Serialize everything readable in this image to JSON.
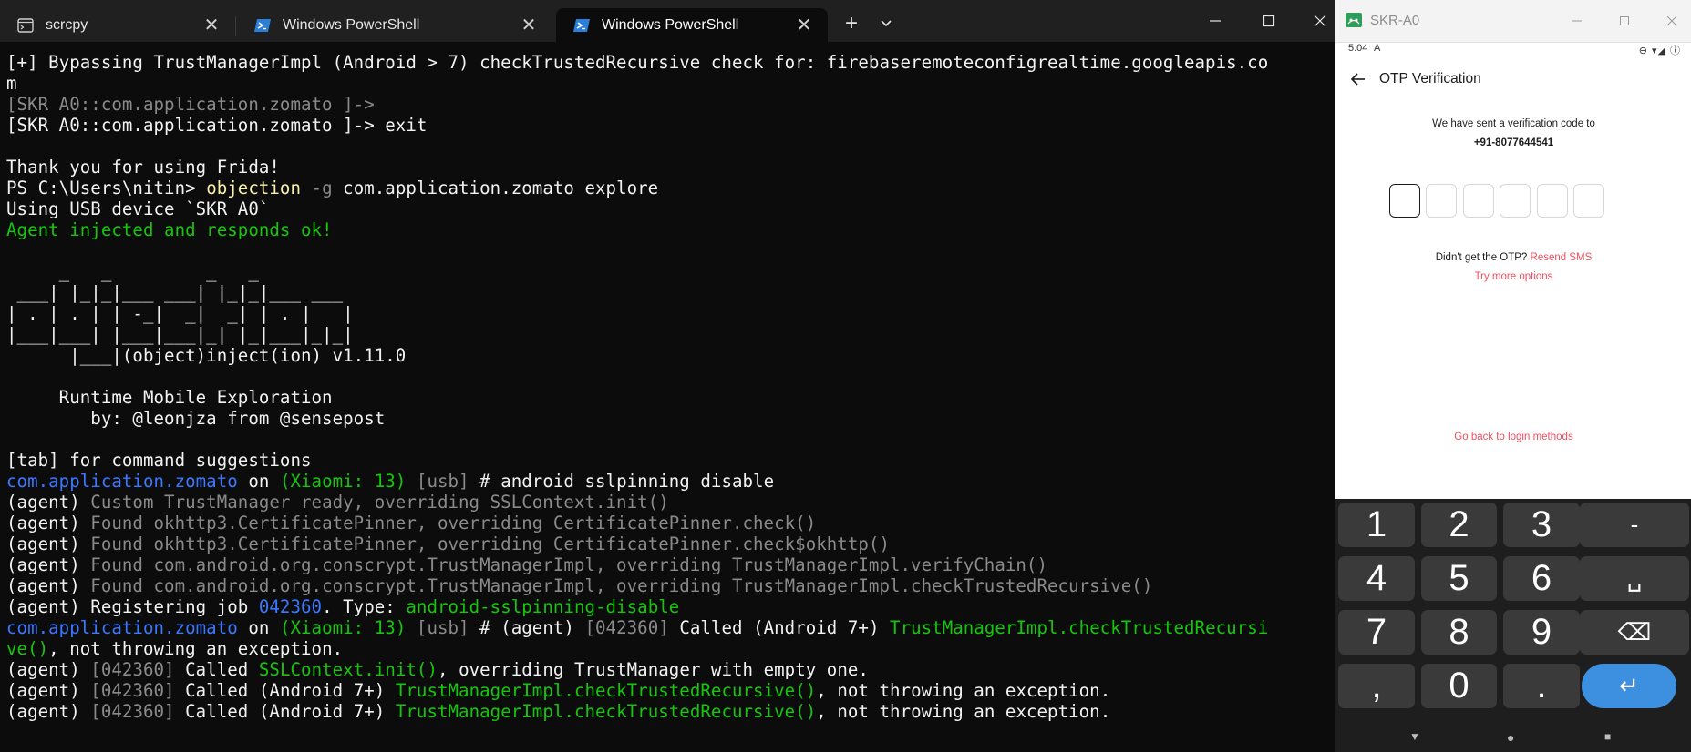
{
  "terminal": {
    "tabs": [
      {
        "title": "scrcpy",
        "icon": "terminal-app-icon",
        "active": false
      },
      {
        "title": "Windows PowerShell",
        "icon": "powershell-icon",
        "active": false
      },
      {
        "title": "Windows PowerShell",
        "icon": "powershell-icon",
        "active": true
      }
    ],
    "new_tab_label": "+",
    "dropdown_label": "⌄",
    "window_controls": {
      "minimize": "—",
      "maximize": "☐",
      "close": "✕"
    },
    "lines": [
      [
        {
          "t": "[+] Bypassing TrustManagerImpl (Android > 7) checkTrustedRecursive check for: firebaseremoteconfigrealtime.googleapis.co",
          "c": "c-white"
        }
      ],
      [
        {
          "t": "m",
          "c": "c-white"
        }
      ],
      [
        {
          "t": "[SKR A0::com.application.zomato ]->",
          "c": "c-grey"
        }
      ],
      [
        {
          "t": "[SKR A0::com.application.zomato ]-> exit",
          "c": "c-white"
        }
      ],
      [
        {
          "t": "",
          "c": ""
        }
      ],
      [
        {
          "t": "Thank you for using Frida!",
          "c": "c-white"
        }
      ],
      [
        {
          "t": "PS C:\\Users\\nitin> ",
          "c": "c-white"
        },
        {
          "t": "objection",
          "c": "c-yellow"
        },
        {
          "t": " -g",
          "c": "c-grey"
        },
        {
          "t": " com.application.zomato explore",
          "c": "c-white"
        }
      ],
      [
        {
          "t": "Using USB device `SKR A0`",
          "c": "c-white"
        }
      ],
      [
        {
          "t": "Agent injected and responds ok!",
          "c": "c-green"
        }
      ],
      [
        {
          "t": "",
          "c": ""
        }
      ],
      [
        {
          "t": "     _   _         _   _",
          "c": "c-white"
        }
      ],
      [
        {
          "t": " ___| |_|_|___ ___| |_|_|___ ___",
          "c": "c-white"
        }
      ],
      [
        {
          "t": "| . | . | | -_|  _|  _| | . |   |",
          "c": "c-white"
        }
      ],
      [
        {
          "t": "|___|___| |___|___|_| |_|___|_|_|",
          "c": "c-white"
        }
      ],
      [
        {
          "t": "      |___|(object)inject(ion) v1.11.0",
          "c": "c-white"
        }
      ],
      [
        {
          "t": "",
          "c": ""
        }
      ],
      [
        {
          "t": "     Runtime Mobile Exploration",
          "c": "c-white"
        }
      ],
      [
        {
          "t": "        by: @leonjza from @sensepost",
          "c": "c-white"
        }
      ],
      [
        {
          "t": "",
          "c": ""
        }
      ],
      [
        {
          "t": "[tab] for command suggestions",
          "c": "c-white"
        }
      ],
      [
        {
          "t": "com.application.zomato",
          "c": "c-blue"
        },
        {
          "t": " on ",
          "c": "c-white"
        },
        {
          "t": "(Xiaomi: 13)",
          "c": "c-green"
        },
        {
          "t": " [usb]",
          "c": "c-grey"
        },
        {
          "t": " # android sslpinning disable",
          "c": "c-white"
        }
      ],
      [
        {
          "t": "(agent)",
          "c": "c-white"
        },
        {
          "t": " Custom TrustManager ready, overriding SSLContext.init()",
          "c": "c-grey"
        }
      ],
      [
        {
          "t": "(agent)",
          "c": "c-white"
        },
        {
          "t": " Found okhttp3.CertificatePinner, overriding CertificatePinner.check()",
          "c": "c-grey"
        }
      ],
      [
        {
          "t": "(agent)",
          "c": "c-white"
        },
        {
          "t": " Found okhttp3.CertificatePinner, overriding CertificatePinner.check$okhttp()",
          "c": "c-grey"
        }
      ],
      [
        {
          "t": "(agent)",
          "c": "c-white"
        },
        {
          "t": " Found com.android.org.conscrypt.TrustManagerImpl, overriding TrustManagerImpl.verifyChain()",
          "c": "c-grey"
        }
      ],
      [
        {
          "t": "(agent)",
          "c": "c-white"
        },
        {
          "t": " Found com.android.org.conscrypt.TrustManagerImpl, overriding TrustManagerImpl.checkTrustedRecursive()",
          "c": "c-grey"
        }
      ],
      [
        {
          "t": "(agent) Registering job ",
          "c": "c-white"
        },
        {
          "t": "042360",
          "c": "c-blue"
        },
        {
          "t": ". Type: ",
          "c": "c-white"
        },
        {
          "t": "android-sslpinning-disable",
          "c": "c-green"
        }
      ],
      [
        {
          "t": "com.application.zomato",
          "c": "c-blue"
        },
        {
          "t": " on ",
          "c": "c-white"
        },
        {
          "t": "(Xiaomi: 13)",
          "c": "c-green"
        },
        {
          "t": " [usb]",
          "c": "c-grey"
        },
        {
          "t": " # (agent) ",
          "c": "c-white"
        },
        {
          "t": "[042360]",
          "c": "c-grey"
        },
        {
          "t": " Called (Android 7+) ",
          "c": "c-white"
        },
        {
          "t": "TrustManagerImpl.checkTrustedRecursi",
          "c": "c-green"
        }
      ],
      [
        {
          "t": "ve()",
          "c": "c-green"
        },
        {
          "t": ", not throwing an exception.",
          "c": "c-white"
        }
      ],
      [
        {
          "t": "(agent) ",
          "c": "c-white"
        },
        {
          "t": "[042360]",
          "c": "c-grey"
        },
        {
          "t": " Called ",
          "c": "c-white"
        },
        {
          "t": "SSLContext.init()",
          "c": "c-green"
        },
        {
          "t": ", overriding TrustManager with empty one.",
          "c": "c-white"
        }
      ],
      [
        {
          "t": "(agent) ",
          "c": "c-white"
        },
        {
          "t": "[042360]",
          "c": "c-grey"
        },
        {
          "t": " Called (Android 7+) ",
          "c": "c-white"
        },
        {
          "t": "TrustManagerImpl.checkTrustedRecursive()",
          "c": "c-green"
        },
        {
          "t": ", not throwing an exception.",
          "c": "c-white"
        }
      ],
      [
        {
          "t": "(agent) ",
          "c": "c-white"
        },
        {
          "t": "[042360]",
          "c": "c-grey"
        },
        {
          "t": " Called (Android 7+) ",
          "c": "c-white"
        },
        {
          "t": "TrustManagerImpl.checkTrustedRecursive()",
          "c": "c-green"
        },
        {
          "t": ", not throwing an exception.",
          "c": "c-white"
        }
      ]
    ]
  },
  "phone": {
    "window_title": "SKR-A0",
    "window_controls": {
      "minimize": "—",
      "maximize": "☐",
      "close": "✕"
    },
    "status": {
      "time": "5:04",
      "left_icon": "A",
      "right_icons": "⊖ ▾◢ ⓘ"
    },
    "appbar": {
      "title": "OTP Verification"
    },
    "sent_text": "We have sent a verification code to",
    "phone_number": "+91-8077644541",
    "otp_box_count": 6,
    "didnt_get": "Didn't get the OTP?",
    "resend": "Resend SMS",
    "more_options": "Try more options",
    "go_back": "Go back to login methods",
    "keypad": {
      "rows": [
        [
          "1",
          "2",
          "3",
          "-"
        ],
        [
          "4",
          "5",
          "6",
          "␣"
        ],
        [
          "7",
          "8",
          "9",
          "⌫"
        ],
        [
          ",",
          "0",
          ".",
          "↵"
        ]
      ]
    },
    "nav": {
      "back": "▼",
      "home": "●",
      "recents": "■"
    },
    "colors": {
      "accent": "#ef4f5f",
      "enter_key": "#3d8fe0",
      "keypad_bg": "#1e1e1e",
      "key_bg": "#3a3a3a"
    }
  }
}
